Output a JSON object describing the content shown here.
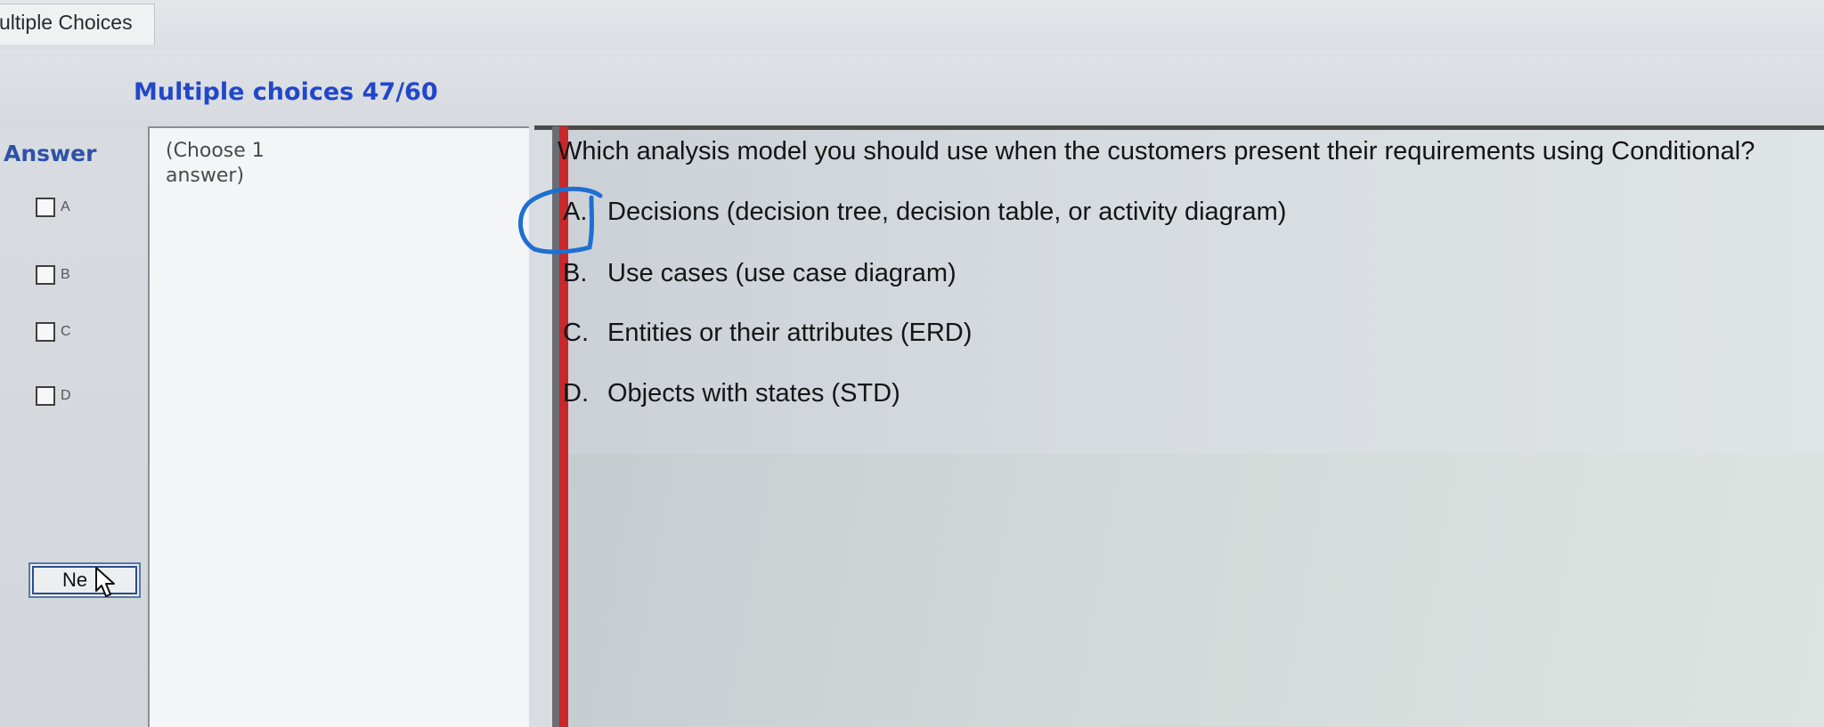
{
  "window": {
    "tab_label": "ultiple Choices"
  },
  "header": {
    "title": "Multiple choices 47/60"
  },
  "answer_panel": {
    "label": "Answer",
    "choices": [
      {
        "letter": "A",
        "checked": false
      },
      {
        "letter": "B",
        "checked": false
      },
      {
        "letter": "C",
        "checked": false
      },
      {
        "letter": "D",
        "checked": false
      }
    ],
    "next_button_label": "Ne"
  },
  "instructions": {
    "text": "(Choose 1 answer)"
  },
  "question": {
    "text": "Which analysis model you should use when the customers present their requirements using Conditional?",
    "options": [
      {
        "letter": "A.",
        "text": "Decisions (decision tree, decision table, or activity diagram)"
      },
      {
        "letter": "B.",
        "text": "Use cases (use case diagram)"
      },
      {
        "letter": "C.",
        "text": "Entities or their attributes (ERD)"
      },
      {
        "letter": "D.",
        "text": "Objects with states (STD)"
      }
    ]
  },
  "colors": {
    "title_blue": "#2247c9",
    "answer_blue": "#2e51a8",
    "red_bar": "#c8282c",
    "annotation_circle": "#1e6fd0"
  },
  "icons": {
    "cursor": "pointer-hand-cursor-icon",
    "annotation": "hand-drawn-circle-icon"
  }
}
